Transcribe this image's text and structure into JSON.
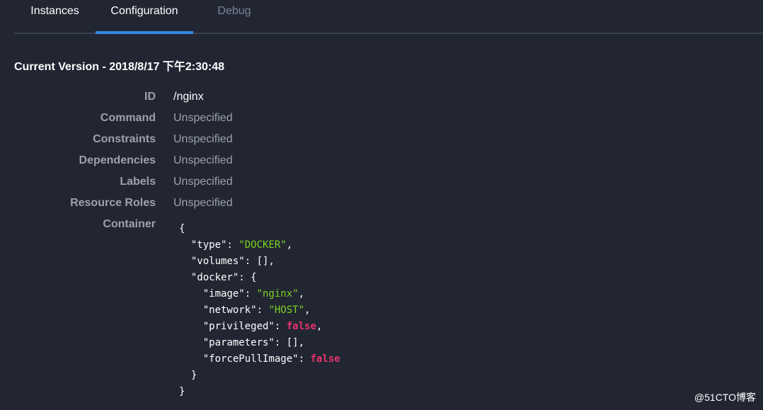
{
  "tabs": {
    "instances": "Instances",
    "configuration": "Configuration",
    "debug": "Debug"
  },
  "colors": {
    "background": "#222633",
    "accent": "#2f8be5",
    "label": "#9ca1ad",
    "string": "#7ed321",
    "boolean": "#e8336d"
  },
  "version_title": "Current Version - 2018/8/17 下午2:30:48",
  "details": {
    "id": {
      "label": "ID",
      "value": "/nginx"
    },
    "command": {
      "label": "Command",
      "value": "Unspecified"
    },
    "constraints": {
      "label": "Constraints",
      "value": "Unspecified"
    },
    "dependencies": {
      "label": "Dependencies",
      "value": "Unspecified"
    },
    "labels": {
      "label": "Labels",
      "value": "Unspecified"
    },
    "resource_roles": {
      "label": "Resource Roles",
      "value": "Unspecified"
    },
    "container": {
      "label": "Container"
    }
  },
  "container_json": {
    "open_brace": "{",
    "close_brace": "}",
    "docker_close": "}",
    "type_key": "\"type\": ",
    "type_value": "\"DOCKER\"",
    "volumes_line": "\"volumes\": [],",
    "docker_key": "\"docker\": {",
    "image_key": "\"image\": ",
    "image_value": "\"nginx\"",
    "network_key": "\"network\": ",
    "network_value": "\"HOST\"",
    "privileged_key": "\"privileged\": ",
    "privileged_value": "false",
    "parameters_line": "\"parameters\": [],",
    "force_pull_key": "\"forcePullImage\": ",
    "force_pull_value": "false",
    "comma": ","
  },
  "watermark": "@51CTO博客"
}
